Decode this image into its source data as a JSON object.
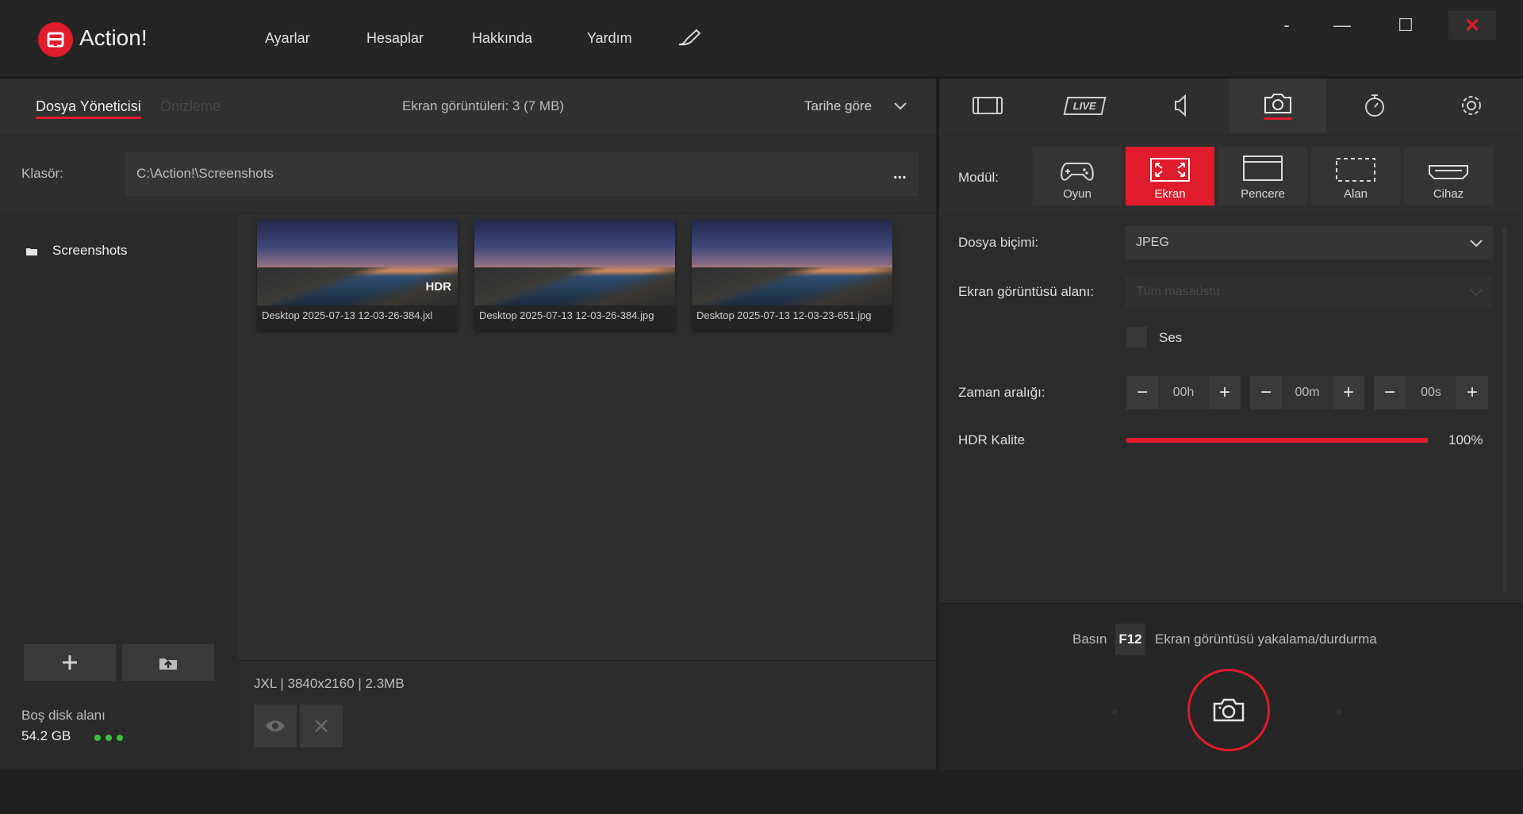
{
  "app": {
    "title": "Action!"
  },
  "menu": {
    "items": [
      "Ayarlar",
      "Hesaplar",
      "Hakkında",
      "Yardım"
    ]
  },
  "window_controls": {
    "minimize": "-",
    "restore": "—",
    "maximize": "☐",
    "close": "✕"
  },
  "left": {
    "tabs": [
      "Dosya Yöneticisi",
      "Önizleme"
    ],
    "count_text": "Ekran görüntüleri: 3 (7 MB)",
    "sort_label": "Tarihe göre",
    "folder_label": "Klasör:",
    "folder_path": "C:\\Action!\\Screenshots",
    "folder_more": "...",
    "tree_item": "Screenshots",
    "thumbnails": [
      {
        "caption": "Desktop 2025-07-13 12-03-26-384.jxl",
        "badge": "HDR"
      },
      {
        "caption": "Desktop 2025-07-13 12-03-26-384.jpg",
        "badge": ""
      },
      {
        "caption": "Desktop 2025-07-13 12-03-23-651.jpg",
        "badge": ""
      }
    ],
    "file_info": "JXL | 3840x2160 | 2.3MB",
    "disk_label": "Boş disk alanı",
    "disk_value": "54.2 GB"
  },
  "right": {
    "module_label": "Modül:",
    "modules": [
      "Oyun",
      "Ekran",
      "Pencere",
      "Alan",
      "Cihaz"
    ],
    "active_module": "Ekran",
    "tab_live": "LIVE",
    "format_label": "Dosya biçimi:",
    "format_value": "JPEG",
    "area_label": "Ekran görüntüsü alanı:",
    "area_value": "Tüm masaüstü",
    "sound_label": "Ses",
    "interval_label": "Zaman aralığı:",
    "interval": {
      "hours": "00h",
      "minutes": "00m",
      "seconds": "00s"
    },
    "hdr_label": "HDR Kalite",
    "hdr_value": "100%",
    "hdr_fraction": 1.0,
    "hotkey_press": "Basın",
    "hotkey_key": "F12",
    "hotkey_action": "Ekran görüntüsü yakalama/durdurma"
  },
  "colors": {
    "accent": "#e01b2b",
    "bg": "#2b2b2b",
    "panel": "#303030",
    "disk_dots": "#3cc13c"
  }
}
